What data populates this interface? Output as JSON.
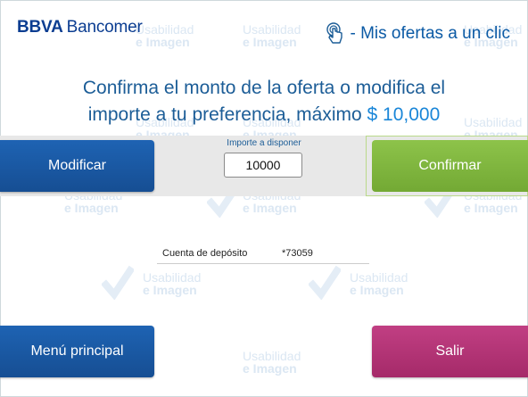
{
  "header": {
    "logo_brand": "BBVA",
    "logo_name": "Bancomer",
    "offers_text": "- Mis ofertas a un clic"
  },
  "headline": {
    "line1": "Confirma el monto de la oferta o modifica el",
    "line2_prefix": "importe a tu preferencia, máximo",
    "line2_amount": "$ 10,000"
  },
  "actions": {
    "modify_label": "Modificar",
    "confirm_label": "Confirmar",
    "main_menu_label": "Menú principal",
    "exit_label": "Salir"
  },
  "amount": {
    "label": "Importe a disponer",
    "value": "10000"
  },
  "deposit": {
    "label": "Cuenta de depósito",
    "value": "*73059"
  },
  "watermark": {
    "line1": "Usabilidad",
    "line2": "e Imagen"
  },
  "colors": {
    "brand_blue": "#0b3d91",
    "button_blue": "#1e63b3",
    "button_green": "#8dc34a",
    "button_pink": "#c13f83",
    "headline_blue": "#1c5d97"
  }
}
